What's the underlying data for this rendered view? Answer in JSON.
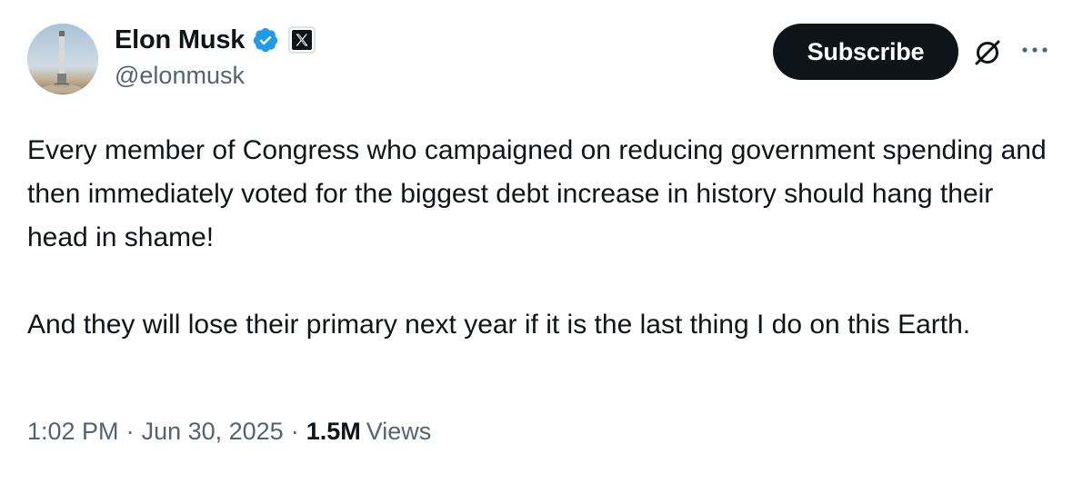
{
  "author": {
    "name": "Elon Musk",
    "handle": "@elonmusk",
    "verified": true,
    "affiliation_badge": "x-logo-icon"
  },
  "actions": {
    "subscribe_label": "Subscribe",
    "grok_icon": "grok-icon",
    "more_icon": "more-dots-icon"
  },
  "tweet": {
    "paragraphs": [
      "Every member of Congress who campaigned on reducing government spending and then immediately voted for the biggest debt increase in history should hang their head in shame!",
      "And they will lose their primary next year if it is the last thing I do on this Earth."
    ]
  },
  "meta": {
    "time": "1:02 PM",
    "separator": "·",
    "date": "Jun 30, 2025",
    "views_count": "1.5M",
    "views_label": "Views"
  },
  "colors": {
    "text_primary": "#0f1419",
    "text_secondary": "#536471",
    "verified_blue": "#1d9bf0",
    "button_dark": "#0f1419"
  }
}
